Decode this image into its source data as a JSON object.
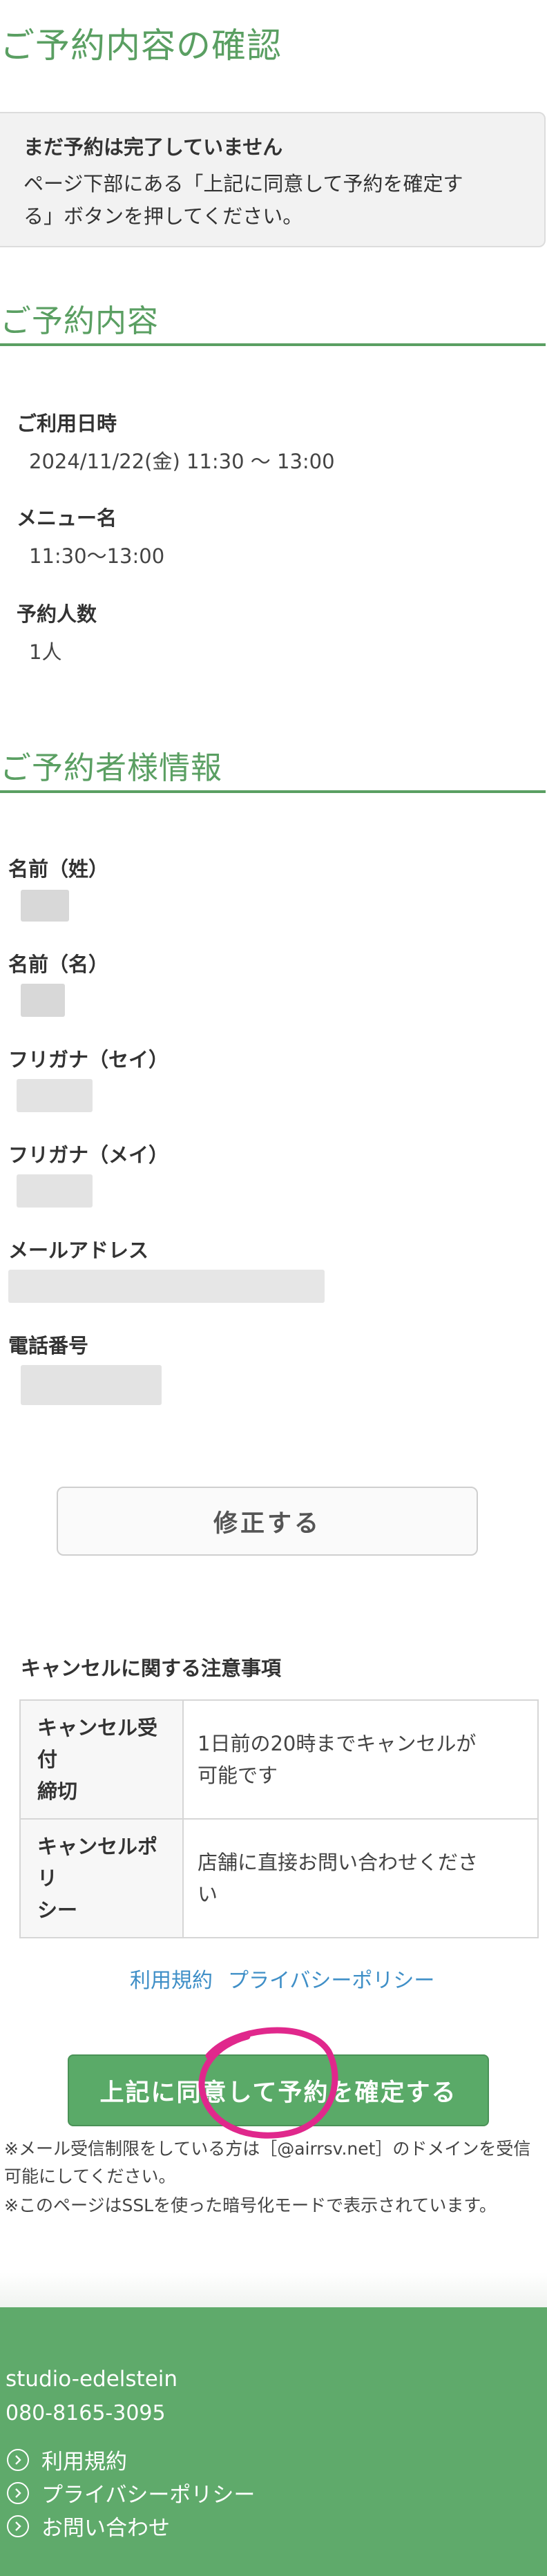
{
  "page": {
    "title": "ご予約内容の確認"
  },
  "notice": {
    "title": "まだ予約は完了していません",
    "line1": "ページ下部にある「上記に同意して予約を確定す",
    "line2": "る」ボタンを押してください。"
  },
  "reservation": {
    "section_title": "ご予約内容",
    "date_label": "ご利用日時",
    "date_value": "2024/11/22(金) 11:30 〜 13:00",
    "menu_label": "メニュー名",
    "menu_value": "11:30〜13:00",
    "people_label": "予約人数",
    "people_value": "1人"
  },
  "customer": {
    "section_title": "ご予約者様情報",
    "last_name_label": "名前（姓）",
    "first_name_label": "名前（名）",
    "kana_last_label": "フリガナ（セイ）",
    "kana_first_label": "フリガナ（メイ）",
    "email_label": "メールアドレス",
    "phone_label": "電話番号"
  },
  "actions": {
    "edit_label": "修正する",
    "confirm_label": "上記に同意して予約を確定する"
  },
  "cancellation": {
    "heading": "キャンセルに関する注意事項",
    "rows": [
      {
        "label_line1": "キャンセル受付",
        "label_line2": "締切",
        "value_line1": "1日前の20時までキャンセルが",
        "value_line2": "可能です"
      },
      {
        "label_line1": "キャンセルポリ",
        "label_line2": "シー",
        "value_line1": "店舗に直接お問い合わせくださ",
        "value_line2": "い"
      }
    ]
  },
  "links": {
    "terms": "利用規約",
    "privacy": "プライバシーポリシー"
  },
  "notes": {
    "line1": "※メール受信制限をしている方は［@airrsv.net］のドメインを受信",
    "line2": "可能にしてください。",
    "line3": "※このページはSSLを使った暗号化モードで表示されています。"
  },
  "footer": {
    "shop_name": "studio-edelstein",
    "phone": "080-8165-3095",
    "links": [
      "利用規約",
      "プライバシーポリシー",
      "お問い合わせ"
    ]
  },
  "colors": {
    "brand_green": "#5a9f62",
    "button_green": "#5aaa68",
    "footer_green": "#5faa6b",
    "link_blue": "#3f8fc7",
    "annotation_magenta": "#e0288c"
  },
  "icons": [
    "chevron-right-icon",
    "handwritten-circle-annotation"
  ]
}
